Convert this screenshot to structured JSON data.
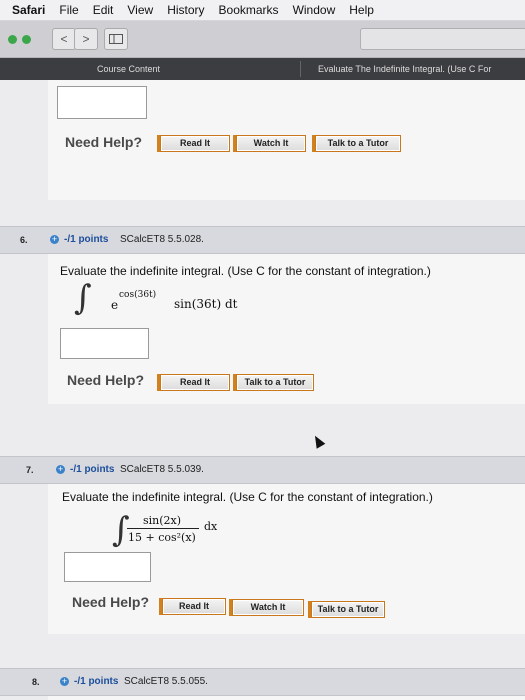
{
  "menubar": {
    "app": "Safari",
    "items": [
      "File",
      "Edit",
      "View",
      "History",
      "Bookmarks",
      "Window",
      "Help"
    ]
  },
  "toolbar": {
    "back_glyph": "<",
    "forward_glyph": ">"
  },
  "tabs": {
    "left": "Course Content",
    "right": "Evaluate The Indefinite Integral. (Use C For"
  },
  "help": {
    "label": "Need Help?",
    "read": "Read It",
    "watch": "Watch It",
    "tutor": "Talk to a Tutor"
  },
  "questions": [
    {
      "number": "6.",
      "points": "-/1 points",
      "source": "SCalcET8 5.5.028.",
      "prompt": "Evaluate the indefinite integral. (Use C for the constant of integration.)",
      "integrand_base": "e",
      "integrand_exp": "cos(36t)",
      "integrand_rest": "sin(36t) dt"
    },
    {
      "number": "7.",
      "points": "-/1 points",
      "source": "SCalcET8 5.5.039.",
      "prompt": "Evaluate the indefinite integral. (Use C for the constant of integration.)",
      "numerator": "sin(2x)",
      "denominator": "15 + cos²(x)",
      "differential": "dx"
    },
    {
      "number": "8.",
      "points": "-/1 points",
      "source": "SCalcET8 5.5.055."
    }
  ],
  "colors": {
    "button_accent": "#d2811f",
    "points_blue": "#1d4e9a",
    "tab_bar": "#3c3d40"
  }
}
